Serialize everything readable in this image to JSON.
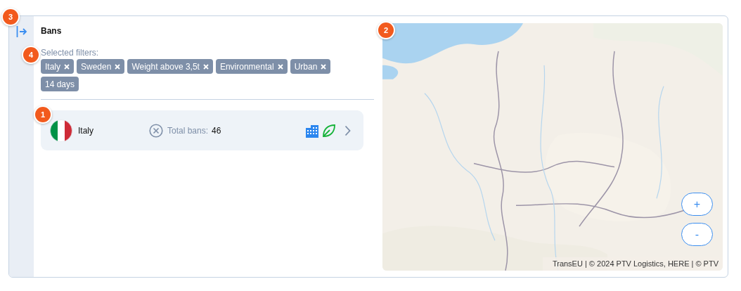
{
  "panel": {
    "title": "Bans",
    "filters_label": "Selected filters:",
    "filters": [
      {
        "label": "Italy",
        "removable": true
      },
      {
        "label": "Sweden",
        "removable": true
      },
      {
        "label": "Weight above 3,5t",
        "removable": true
      },
      {
        "label": "Environmental",
        "removable": true
      },
      {
        "label": "Urban",
        "removable": true
      },
      {
        "label": "14 days",
        "removable": false
      }
    ],
    "countries": [
      {
        "name": "Italy",
        "flag": {
          "kind": "italy"
        },
        "total_label": "Total bans:",
        "total": "46",
        "categories": [
          {
            "kind": "urban"
          },
          {
            "kind": "environmental"
          }
        ]
      }
    ]
  },
  "map": {
    "kind": "picture",
    "zoom_in": "+",
    "zoom_out": "-",
    "attribution": "TransEU | © 2024 PTV Logistics, HERE | © PTV"
  },
  "markers": [
    {
      "label": "1"
    },
    {
      "label": "2"
    },
    {
      "label": "3"
    },
    {
      "label": "4"
    }
  ]
}
